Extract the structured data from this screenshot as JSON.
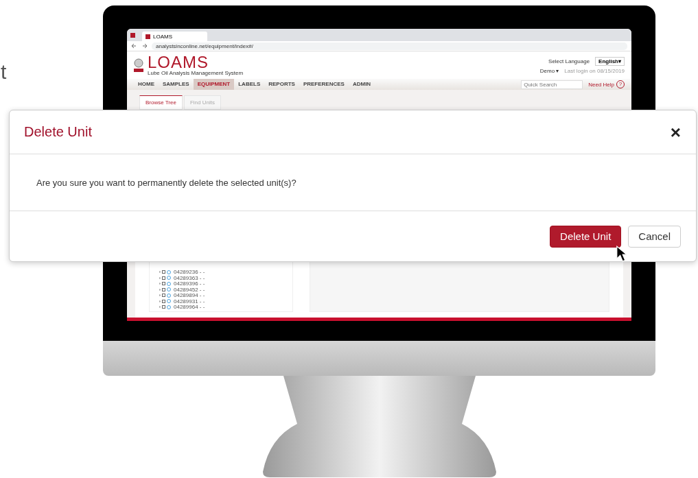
{
  "side_text": "t",
  "browser": {
    "tab_title": "LOAMS",
    "url": "analystsinconline.net/equipment/index#/"
  },
  "header": {
    "logo": "LOAMS",
    "tagline": "Lube Oil Analysis Management System",
    "language_label": "Select Language",
    "language": "English▾",
    "user": "Demo ▾",
    "last_login": "Last login on 08/15/2019"
  },
  "nav": [
    {
      "label": "HOME",
      "selected": false
    },
    {
      "label": "SAMPLES",
      "selected": false
    },
    {
      "label": "EQUIPMENT",
      "selected": true
    },
    {
      "label": "LABELS",
      "selected": false
    },
    {
      "label": "REPORTS",
      "selected": false
    },
    {
      "label": "PREFERENCES",
      "selected": false
    },
    {
      "label": "ADMIN",
      "selected": false
    }
  ],
  "quick_search": {
    "placeholder": "Quick Search"
  },
  "help": "Need Help",
  "help_icon": "?",
  "tabs": [
    {
      "label": "Browse Tree",
      "selected": true
    },
    {
      "label": "Find Units",
      "selected": false
    }
  ],
  "tree": [
    {
      "label": "04289236 - -",
      "checked": false
    },
    {
      "label": "04289363 - -",
      "checked": false
    },
    {
      "label": "04289396 - -",
      "checked": false
    },
    {
      "label": "04289452 - -",
      "checked": false
    },
    {
      "label": "04289894 - -",
      "checked": false
    },
    {
      "label": "04289931 - -",
      "checked": false
    },
    {
      "label": "04289964 - -",
      "checked": false
    }
  ],
  "dialog": {
    "title": "Delete Unit",
    "close": "×",
    "message": "Are you sure you want to permanently delete the selected unit(s)?",
    "buttons": [
      {
        "label": "Delete Unit",
        "kind": "primary"
      },
      {
        "label": "Cancel",
        "kind": "secondary"
      }
    ]
  }
}
